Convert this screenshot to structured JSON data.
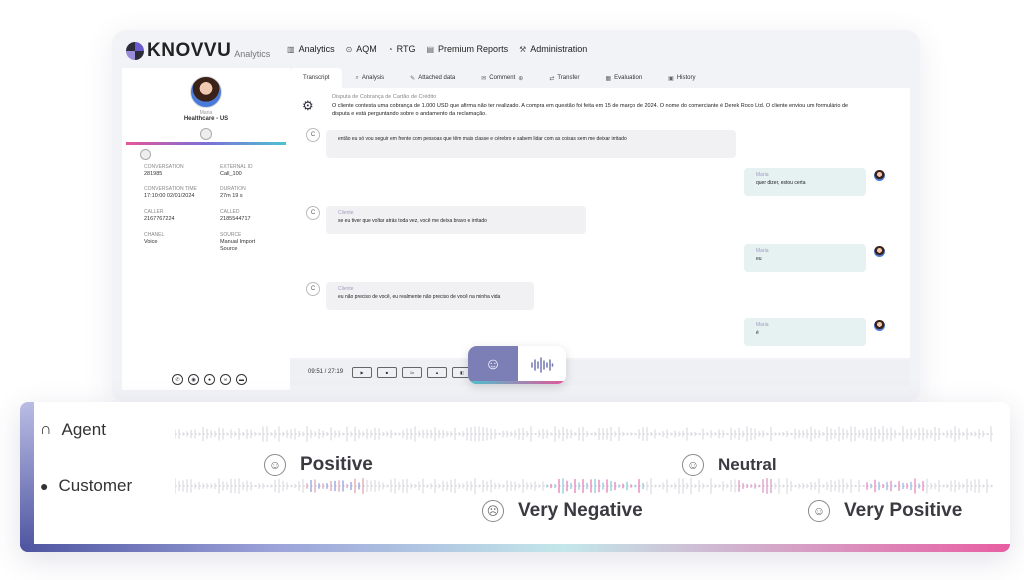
{
  "app": {
    "logo_text": "KNOVVU",
    "logo_sub": "Analytics"
  },
  "nav": [
    {
      "icon": "bar-chart-icon",
      "label": "Analytics"
    },
    {
      "icon": "aqm-icon",
      "label": "AQM"
    },
    {
      "icon": "rtg-icon",
      "label": "RTG"
    },
    {
      "icon": "report-icon",
      "label": "Premium Reports"
    },
    {
      "icon": "admin-icon",
      "label": "Administration"
    }
  ],
  "sidebar": {
    "agent_name": "Maria",
    "team": "Healthcare - US",
    "fields": [
      {
        "label": "CONVERSATION",
        "value": "281985"
      },
      {
        "label": "EXTERNAL ID",
        "value": "Call_100"
      },
      {
        "label": "CONVERSATION TIME",
        "value": "17:10:00   02/01/2024"
      },
      {
        "label": "DURATION",
        "value": "27m 19 s"
      },
      {
        "label": "CALLER",
        "value": "2167767224"
      },
      {
        "label": "CALLED",
        "value": "2185544717"
      },
      {
        "label": "CHANEL",
        "value": "Voice"
      },
      {
        "label": "SOURCE",
        "value": "Manual Import Source"
      }
    ]
  },
  "tabs": [
    {
      "label": "Transcript",
      "active": true
    },
    {
      "label": "Analysis"
    },
    {
      "label": "Attached data"
    },
    {
      "label": "Comment"
    },
    {
      "label": "Transfer"
    },
    {
      "label": "Evaluation"
    },
    {
      "label": "History"
    }
  ],
  "summary": {
    "title": "Disputa de Cobrança de Cartão de Crédito",
    "text": "O cliente contesta uma cobrança de 1.000 USD que afirma não ter realizado. A compra em questão foi feita em 15 de março de 2024. O nome do comerciante é Derek Roco Ltd. O cliente enviou um formulário de disputa e está perguntando sobre o andamento da reclamação."
  },
  "messages": [
    {
      "side": "left",
      "who": "",
      "text": "então eu só vou seguir em frente com pessoas que têm mais classe e cérebro e sabem lidar com as coisas sem me deixar irritado"
    },
    {
      "side": "right",
      "who": "Maria",
      "text": "quer dizer, estou certa"
    },
    {
      "side": "left",
      "who": "Cliente",
      "text": "se eu tiver que voltar atrás toda vez, você me deixa bravo e irritado"
    },
    {
      "side": "right",
      "who": "Maria",
      "text": "eu"
    },
    {
      "side": "left",
      "who": "Cliente",
      "text": "eu não preciso de você, eu realmente não preciso de você na minha vida"
    },
    {
      "side": "right",
      "who": "Maria",
      "text": "é"
    }
  ],
  "player": {
    "time": "09:51 / 27:19",
    "speed": "1x"
  },
  "tracks": {
    "agent": "Agent",
    "customer": "Customer"
  },
  "sentiments": {
    "positive": "Positive",
    "neutral": "Neutral",
    "very_negative": "Very Negative",
    "very_positive": "Very Positive"
  }
}
